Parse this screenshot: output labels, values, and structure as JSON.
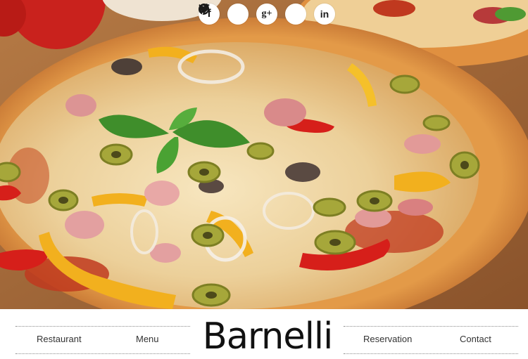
{
  "social": {
    "icons": [
      "facebook-icon",
      "twitter-icon",
      "google-plus-icon",
      "pinterest-icon",
      "linkedin-icon"
    ],
    "facebook": "f",
    "google_plus": "g+",
    "linkedin": "in"
  },
  "nav": {
    "restaurant": "Restaurant",
    "menu": "Menu",
    "reservation": "Reservation",
    "contact": "Contact"
  },
  "brand": "Barnelli",
  "colors": {
    "crust": "#d98a3a",
    "sauce": "#c0391f",
    "cheese": "#efd9a8",
    "pepper_red": "#d61f1a",
    "pepper_yellow": "#f2b01e",
    "olive": "#a6a73a",
    "basil": "#3f8e2b",
    "text": "#333333"
  }
}
